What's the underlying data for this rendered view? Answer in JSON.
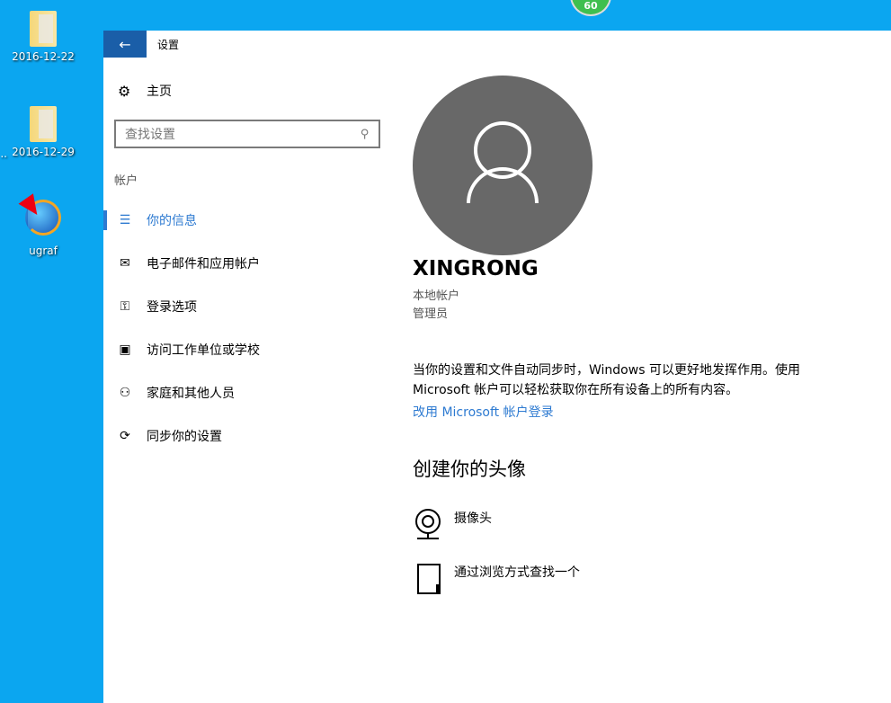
{
  "desktop": {
    "icons": [
      {
        "label": "2016-12-22"
      },
      {
        "label": "2016-12-29"
      },
      {
        "label": "ugraf"
      }
    ],
    "edge_label": "..",
    "badge": "60"
  },
  "window": {
    "title": "设置",
    "back_icon": "back-arrow-icon"
  },
  "sidebar": {
    "home": "主页",
    "search_placeholder": "查找设置",
    "section": "帐户",
    "items": [
      {
        "label": "你的信息",
        "icon": "user-info-icon"
      },
      {
        "label": "电子邮件和应用帐户",
        "icon": "mail-icon"
      },
      {
        "label": "登录选项",
        "icon": "key-icon"
      },
      {
        "label": "访问工作单位或学校",
        "icon": "briefcase-icon"
      },
      {
        "label": "家庭和其他人员",
        "icon": "person-add-icon"
      },
      {
        "label": "同步你的设置",
        "icon": "sync-icon"
      }
    ]
  },
  "main": {
    "username": "XINGRONG",
    "account_type": "本地帐户",
    "role": "管理员",
    "description": "当你的设置和文件自动同步时，Windows 可以更好地发挥作用。使用 Microsoft 帐户可以轻松获取你在所有设备上的所有内容。",
    "link": "改用 Microsoft 帐户登录",
    "avatar_heading": "创建你的头像",
    "options": [
      {
        "label": "摄像头",
        "icon": "camera-icon"
      },
      {
        "label": "通过浏览方式查找一个",
        "icon": "browse-file-icon"
      }
    ]
  },
  "colors": {
    "accent": "#2d7ad1",
    "desktop": "#0ba6f0",
    "avatar": "#686868"
  }
}
